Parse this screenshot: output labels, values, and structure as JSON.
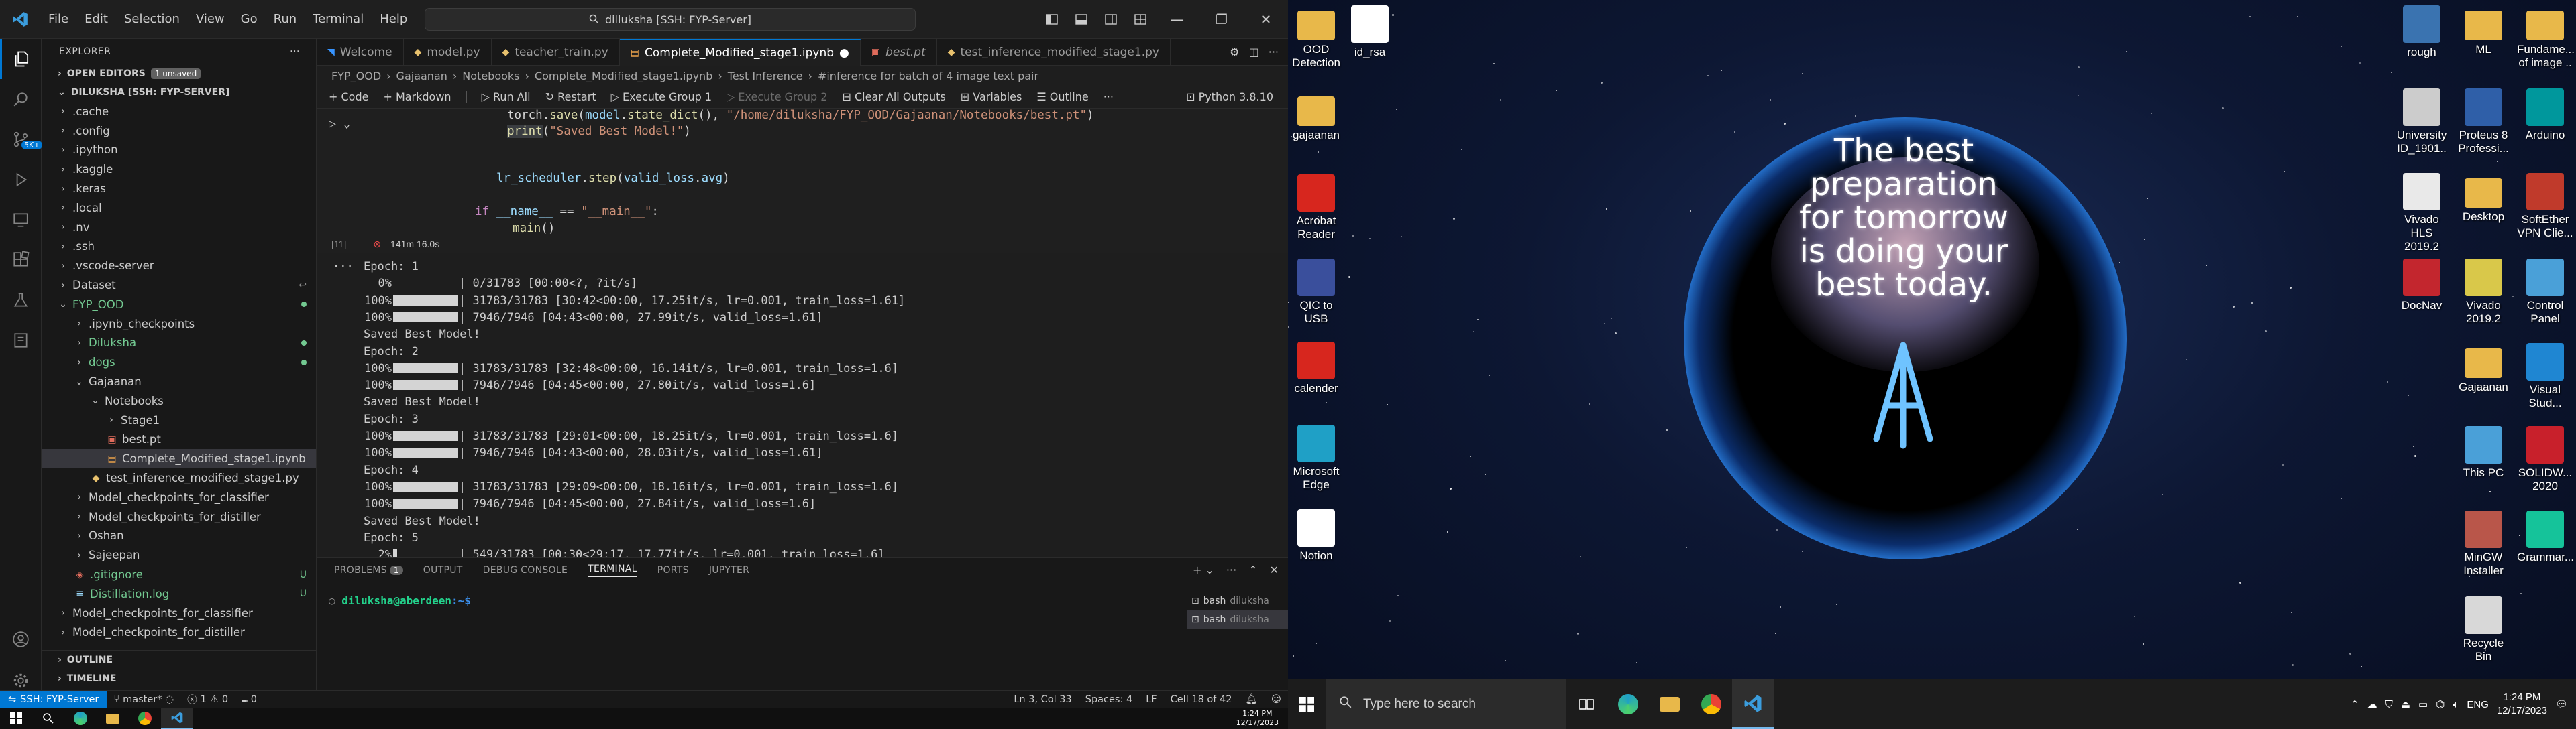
{
  "vscode": {
    "menu": [
      "File",
      "Edit",
      "Selection",
      "View",
      "Go",
      "Run",
      "Terminal",
      "Help"
    ],
    "command_center": "dilluksha [SSH: FYP-Server]",
    "tabs": [
      {
        "label": "Welcome",
        "icon": "vscode-icon",
        "color": "#3794ff"
      },
      {
        "label": "model.py",
        "icon": "python-icon",
        "color": "#e8c16d"
      },
      {
        "label": "teacher_train.py",
        "icon": "python-icon",
        "color": "#e8c16d"
      },
      {
        "label": "Complete_Modified_stage1.ipynb",
        "icon": "notebook-icon",
        "color": "#e8a04a",
        "active": true,
        "dirty": true
      },
      {
        "label": "best.pt",
        "icon": "file-icon",
        "color": "#e06c5c"
      },
      {
        "label": "test_inference_modified_stage1.py",
        "icon": "python-icon",
        "color": "#e8c16d"
      }
    ],
    "breadcrumb": [
      "FYP_OOD",
      "Gajaanan",
      "Notebooks",
      "Complete_Modified_stage1.ipynb",
      "Test Inference",
      "#inference for batch of 4 image text pair"
    ],
    "toolbar": {
      "code": "+ Code",
      "markdown": "+ Markdown",
      "run_all": "Run All",
      "restart": "Restart",
      "execute_group_1": "Execute Group 1",
      "execute_group_2": "Execute Group 2",
      "clear_outputs": "Clear All Outputs",
      "variables": "Variables",
      "outline": "Outline",
      "more": "···",
      "kernel": "Python 3.8.10"
    },
    "code_lines": [
      {
        "segments": [
          {
            "t": "torch",
            "c": "pl"
          },
          {
            "t": ".",
            "c": "pl"
          },
          {
            "t": "save",
            "c": "fn"
          },
          {
            "t": "(",
            "c": "pl"
          },
          {
            "t": "model",
            "c": "var"
          },
          {
            "t": ".",
            "c": "pl"
          },
          {
            "t": "state_dict",
            "c": "fn"
          },
          {
            "t": "(), ",
            "c": "pl"
          },
          {
            "t": "\"/home/diluksha/FYP_OOD/Gajaanan/Notebooks/best.pt\"",
            "c": "str"
          },
          {
            "t": ")",
            "c": "pl"
          }
        ]
      },
      {
        "segments": [
          {
            "t": "print",
            "c": "fn"
          },
          {
            "t": "(",
            "c": "pl"
          },
          {
            "t": "\"Saved Best Model!\"",
            "c": "str"
          },
          {
            "t": ")",
            "c": "pl"
          }
        ]
      },
      {
        "segments": [
          {
            "t": "",
            "c": "pl"
          }
        ]
      },
      {
        "segments": [
          {
            "t": "lr_scheduler",
            "c": "var"
          },
          {
            "t": ".",
            "c": "pl"
          },
          {
            "t": "step",
            "c": "fn"
          },
          {
            "t": "(",
            "c": "pl"
          },
          {
            "t": "valid_loss",
            "c": "var"
          },
          {
            "t": ".",
            "c": "pl"
          },
          {
            "t": "avg",
            "c": "var"
          },
          {
            "t": ")",
            "c": "pl"
          }
        ]
      },
      {
        "segments": [
          {
            "t": "",
            "c": "pl"
          }
        ]
      },
      {
        "segments": [
          {
            "t": "if ",
            "c": "kw"
          },
          {
            "t": "__name__",
            "c": "var"
          },
          {
            "t": " == ",
            "c": "pl"
          },
          {
            "t": "\"__main__\"",
            "c": "str"
          },
          {
            "t": ":",
            "c": "pl"
          }
        ]
      },
      {
        "segments": [
          {
            "t": "    main",
            "c": "fn"
          },
          {
            "t": "()",
            "c": "pl"
          }
        ]
      }
    ],
    "cell": {
      "number": "[11]",
      "status": "⊗",
      "duration": "141m 16.0s"
    },
    "output_lines": [
      {
        "text": "Epoch: 1"
      },
      {
        "pct": "0%",
        "bar": "empty",
        "text": "| 0/31783 [00:00<?, ?it/s]"
      },
      {
        "pct": "100%",
        "bar": "full",
        "text": "| 31783/31783 [30:42<00:00, 17.25it/s, lr=0.001, train_loss=1.61]"
      },
      {
        "pct": "100%",
        "bar": "full",
        "text": "| 7946/7946 [04:43<00:00, 27.99it/s, valid_loss=1.61]"
      },
      {
        "text": "Saved Best Model!"
      },
      {
        "text": "Epoch: 2"
      },
      {
        "pct": "100%",
        "bar": "full",
        "text": "| 31783/31783 [32:48<00:00, 16.14it/s, lr=0.001, train_loss=1.6]"
      },
      {
        "pct": "100%",
        "bar": "full",
        "text": "| 7946/7946 [04:45<00:00, 27.80it/s, valid_loss=1.6]"
      },
      {
        "text": "Saved Best Model!"
      },
      {
        "text": "Epoch: 3"
      },
      {
        "pct": "100%",
        "bar": "full",
        "text": "| 31783/31783 [29:01<00:00, 18.25it/s, lr=0.001, train_loss=1.6]"
      },
      {
        "pct": "100%",
        "bar": "full",
        "text": "| 7946/7946 [04:43<00:00, 28.03it/s, valid_loss=1.61]"
      },
      {
        "text": "Epoch: 4"
      },
      {
        "pct": "100%",
        "bar": "full",
        "text": "| 31783/31783 [29:09<00:00, 18.16it/s, lr=0.001, train_loss=1.6]"
      },
      {
        "pct": "100%",
        "bar": "full",
        "text": "| 7946/7946 [04:45<00:00, 27.84it/s, valid_loss=1.6]"
      },
      {
        "text": "Saved Best Model!"
      },
      {
        "text": "Epoch: 5"
      },
      {
        "pct": "2%",
        "bar": "tiny",
        "text": "| 549/31783 [00:30<29:17, 17.77it/s, lr=0.001, train_loss=1.6]"
      }
    ],
    "sidebar": {
      "title": "EXPLORER",
      "open_editors": "OPEN EDITORS",
      "unsaved_badge": "1 unsaved",
      "root": "DILUKSHA [SSH: FYP-SERVER]",
      "tree": [
        {
          "label": ".cache",
          "kind": "folder",
          "indent": 0,
          "open": false
        },
        {
          "label": ".config",
          "kind": "folder",
          "indent": 0,
          "open": false
        },
        {
          "label": ".ipython",
          "kind": "folder",
          "indent": 0,
          "open": false
        },
        {
          "label": ".kaggle",
          "kind": "folder",
          "indent": 0,
          "open": false
        },
        {
          "label": ".keras",
          "kind": "folder",
          "indent": 0,
          "open": false
        },
        {
          "label": ".local",
          "kind": "folder",
          "indent": 0,
          "open": false
        },
        {
          "label": ".nv",
          "kind": "folder",
          "indent": 0,
          "open": false
        },
        {
          "label": ".ssh",
          "kind": "folder",
          "indent": 0,
          "open": false
        },
        {
          "label": ".vscode-server",
          "kind": "folder",
          "indent": 0,
          "open": false
        },
        {
          "label": "Dataset",
          "kind": "folder",
          "indent": 0,
          "open": false,
          "mark": "↩",
          "markColor": "#8a8a8a"
        },
        {
          "label": "FYP_OOD",
          "kind": "folder",
          "indent": 0,
          "open": true,
          "color": "#73c991",
          "mark": "dot"
        },
        {
          "label": ".ipynb_checkpoints",
          "kind": "folder",
          "indent": 1,
          "open": false
        },
        {
          "label": "Diluksha",
          "kind": "folder",
          "indent": 1,
          "open": false,
          "color": "#73c991",
          "mark": "dot"
        },
        {
          "label": "dogs",
          "kind": "folder",
          "indent": 1,
          "open": false,
          "color": "#73c991",
          "mark": "dot"
        },
        {
          "label": "Gajaanan",
          "kind": "folder",
          "indent": 1,
          "open": true
        },
        {
          "label": "Notebooks",
          "kind": "folder",
          "indent": 2,
          "open": true
        },
        {
          "label": "Stage1",
          "kind": "folder",
          "indent": 3,
          "open": false
        },
        {
          "label": "best.pt",
          "kind": "pt",
          "indent": 3
        },
        {
          "label": "Complete_Modified_stage1.ipynb",
          "kind": "ipynb",
          "indent": 3,
          "selected": true
        },
        {
          "label": "test_inference_modified_stage1.py",
          "kind": "py",
          "indent": 2
        },
        {
          "label": "Model_checkpoints_for_classifier",
          "kind": "folder",
          "indent": 1,
          "open": false
        },
        {
          "label": "Model_checkpoints_for_distiller",
          "kind": "folder",
          "indent": 1,
          "open": false
        },
        {
          "label": "Oshan",
          "kind": "folder",
          "indent": 1,
          "open": false
        },
        {
          "label": "Sajeepan",
          "kind": "folder",
          "indent": 1,
          "open": false
        },
        {
          "label": ".gitignore",
          "kind": "git",
          "indent": 1,
          "color": "#73c991",
          "mark": "U"
        },
        {
          "label": "Distillation.log",
          "kind": "log",
          "indent": 1,
          "color": "#73c991",
          "mark": "U"
        },
        {
          "label": "Model_checkpoints_for_classifier",
          "kind": "folder",
          "indent": 0,
          "open": false
        },
        {
          "label": "Model_checkpoints_for_distiller",
          "kind": "folder",
          "indent": 0,
          "open": false
        }
      ],
      "outline": "OUTLINE",
      "timeline": "TIMELINE"
    },
    "panel": {
      "tabs": [
        "PROBLEMS",
        "OUTPUT",
        "DEBUG CONSOLE",
        "TERMINAL",
        "PORTS",
        "JUPYTER"
      ],
      "problems_count": "1",
      "prompt_user": "diluksha@aberdeen",
      "prompt_path": ":~$",
      "terminals": [
        {
          "name": "bash",
          "sub": "diluksha",
          "active": false
        },
        {
          "name": "bash",
          "sub": "diluksha",
          "active": true
        }
      ]
    },
    "statusbar": {
      "remote": "SSH: FYP-Server",
      "branch": "master*",
      "errors": "1",
      "warnings": "0",
      "ports": "0",
      "position": "Ln 3, Col 33",
      "spaces": "Spaces: 4",
      "eol": "LF",
      "cell": "Cell 18 of 42"
    },
    "taskbar_clock": {
      "time": "1:24 PM",
      "date": "12/17/2023"
    }
  },
  "desktop": {
    "quote": "The best preparation for tomorrow is doing your best today.",
    "left_icons": [
      {
        "label": "OOD Detection",
        "icon": "folder-icon",
        "bg": "#e8b84a"
      },
      {
        "label": "id_rsa",
        "icon": "file-icon",
        "bg": "#ffffff"
      },
      {
        "label": "gajaanan",
        "icon": "folder-icon",
        "bg": "#e8b84a"
      },
      {
        "label": "Acrobat Reader",
        "icon": "acrobat-icon",
        "bg": "#d7261e"
      },
      {
        "label": "QIC to USB",
        "icon": "app-icon",
        "bg": "#3a4f9c"
      },
      {
        "label": "calender",
        "icon": "pdf-icon",
        "bg": "#d7261e"
      },
      {
        "label": "Microsoft Edge",
        "icon": "edge-icon",
        "bg": "#1fa0c6"
      },
      {
        "label": "Notion",
        "icon": "notion-icon",
        "bg": "#ffffff"
      }
    ],
    "right_icons": [
      {
        "label": "rough",
        "icon": "python-icon",
        "bg": "#3a73b0"
      },
      {
        "label": "ML",
        "icon": "folder-icon",
        "bg": "#e8b84a"
      },
      {
        "label": "Fundame... of image ..",
        "icon": "folder-icon",
        "bg": "#e8b84a"
      },
      {
        "label": "University ID_1901..",
        "icon": "file-icon",
        "bg": "#cccccc"
      },
      {
        "label": "Proteus 8 Professi...",
        "icon": "proteus-icon",
        "bg": "#2f5fa8"
      },
      {
        "label": "Arduino",
        "icon": "arduino-icon",
        "bg": "#00979c"
      },
      {
        "label": "Vivado HLS 2019.2",
        "icon": "vivado-hls-icon",
        "bg": "#e9e9e9"
      },
      {
        "label": "Desktop",
        "icon": "folder-icon",
        "bg": "#e8b84a"
      },
      {
        "label": "SoftEther VPN Clie...",
        "icon": "vpn-icon",
        "bg": "#c03a2b"
      },
      {
        "label": "DocNav",
        "icon": "docnav-icon",
        "bg": "#c3262e"
      },
      {
        "label": "Vivado 2019.2",
        "icon": "vivado-icon",
        "bg": "#d9c84a"
      },
      {
        "label": "Control Panel",
        "icon": "control-panel-icon",
        "bg": "#4aa0d8"
      },
      {
        "label": "Gajaanan",
        "icon": "folder-icon",
        "bg": "#e8b84a"
      },
      {
        "label": "Visual Stud...",
        "icon": "vscode-icon",
        "bg": "#1f86d2"
      },
      {
        "label": "This PC",
        "icon": "this-pc-icon",
        "bg": "#4aa0d8"
      },
      {
        "label": "SOLIDW... 2020",
        "icon": "solidworks-icon",
        "bg": "#c8202b"
      },
      {
        "label": "MinGW Installer",
        "icon": "mingw-icon",
        "bg": "#b9564a"
      },
      {
        "label": "Grammar...",
        "icon": "grammarly-icon",
        "bg": "#15c39a"
      },
      {
        "label": "Recycle Bin",
        "icon": "recycle-bin-icon",
        "bg": "#d8d8d8"
      }
    ],
    "taskbar": {
      "search_placeholder": "Type here to search",
      "lang": "ENG",
      "time": "1:24 PM",
      "date": "12/17/2023"
    }
  }
}
